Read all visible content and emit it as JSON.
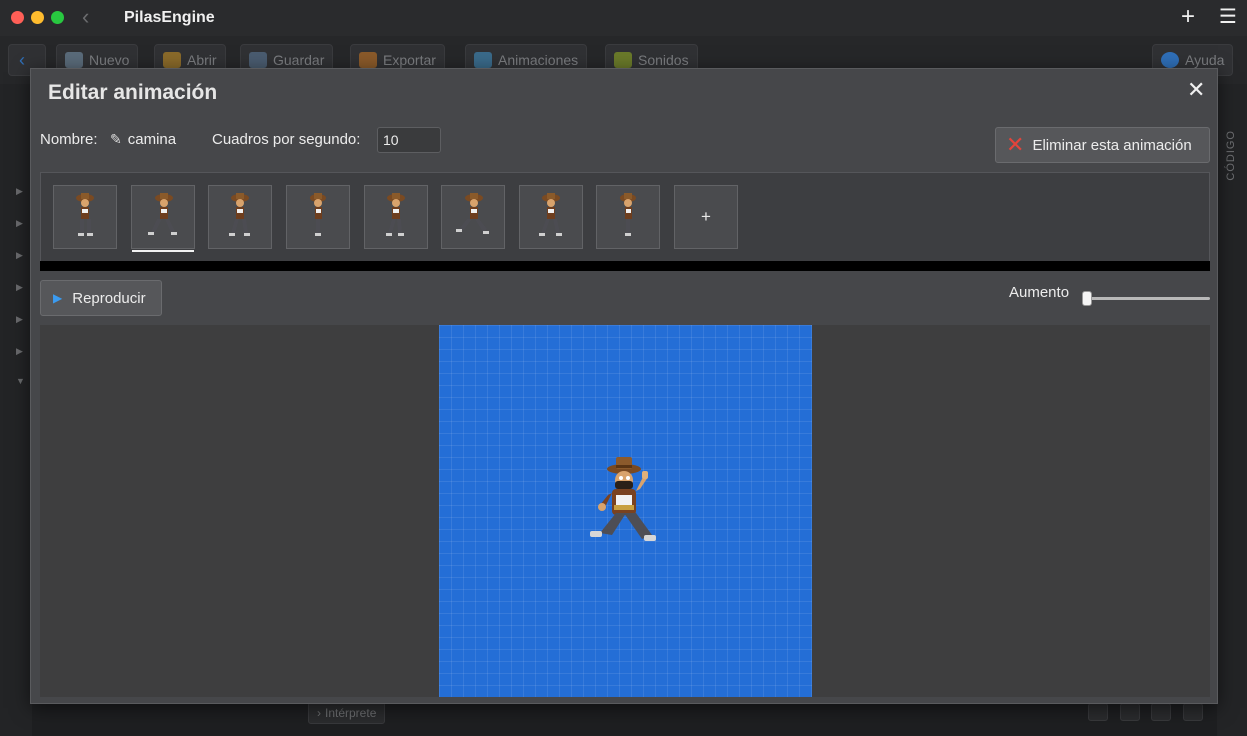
{
  "window": {
    "title": "PilasEngine",
    "plus_glyph": "+",
    "menu_glyph": "☰",
    "back_glyph": "‹"
  },
  "app_toolbar": {
    "buttons": [
      {
        "label": "Nuevo",
        "icon": "new-file-icon"
      },
      {
        "label": "Abrir",
        "icon": "folder-icon"
      },
      {
        "label": "Guardar",
        "icon": "save-icon"
      },
      {
        "label": "Exportar",
        "icon": "export-icon"
      },
      {
        "label": "Animaciones",
        "icon": "animation-icon"
      },
      {
        "label": "Sonidos",
        "icon": "sound-icon"
      }
    ],
    "help_label": "Ayuda",
    "side_label": "CÓDIGO",
    "interpreter_label": "Intérprete"
  },
  "modal": {
    "title": "Editar animación",
    "close_glyph": "✕",
    "name_label": "Nombre:",
    "name_value": "camina",
    "fps_label": "Cuadros por segundo:",
    "fps_value": "10",
    "delete_label": "Eliminar esta animación",
    "frames": [
      {
        "icon": "frame-1-sprite"
      },
      {
        "icon": "frame-2-sprite",
        "selected": true
      },
      {
        "icon": "frame-3-sprite"
      },
      {
        "icon": "frame-4-sprite"
      },
      {
        "icon": "frame-5-sprite"
      },
      {
        "icon": "frame-6-sprite"
      },
      {
        "icon": "frame-7-sprite"
      },
      {
        "icon": "frame-8-sprite"
      }
    ],
    "add_frame_glyph": "+",
    "play_label": "Reproducir",
    "zoom_label": "Aumento",
    "zoom_level": 0
  },
  "colors": {
    "canvas_bg": "#246ed6",
    "delete_icon": "#e2443b",
    "play_icon": "#3b9bf0"
  }
}
